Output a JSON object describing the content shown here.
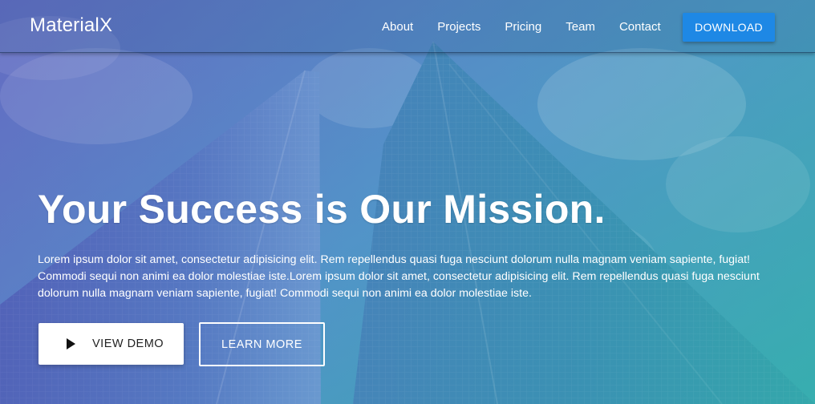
{
  "brand": "MaterialX",
  "nav": {
    "links": [
      "About",
      "Projects",
      "Pricing",
      "Team",
      "Contact"
    ],
    "download_label": "DOWNLOAD"
  },
  "hero": {
    "headline": "Your Success is Our Mission.",
    "lead": "Lorem ipsum dolor sit amet, consectetur adipisicing elit. Rem repellendus quasi fuga nesciunt dolorum nulla magnam veniam sapiente, fugiat! Commodi sequi non animi ea dolor molestiae iste.Lorem ipsum dolor sit amet, consectetur adipisicing elit. Rem repellendus quasi fuga nesciunt dolorum nulla magnam veniam sapiente, fugiat! Commodi sequi non animi ea dolor molestiae iste.",
    "view_demo_label": "VIEW DEMO",
    "learn_more_label": "LEARN MORE"
  },
  "colors": {
    "accent": "#1e88e5",
    "gradient_start": "#5a63b8",
    "gradient_end": "#2fa8a8"
  },
  "icons": {
    "view_demo": "play-icon"
  }
}
